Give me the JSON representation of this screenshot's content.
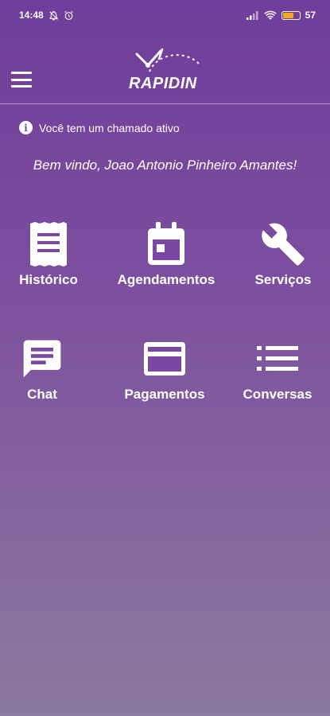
{
  "status_bar": {
    "time": "14:48",
    "battery": "57"
  },
  "header": {
    "logo_text": "RAPIDIN"
  },
  "notice": {
    "text": "Você tem um chamado ativo"
  },
  "welcome": {
    "text": "Bem vindo, Joao Antonio Pinheiro Amantes!"
  },
  "menu": [
    {
      "label": "Histórico",
      "icon": "receipt-icon"
    },
    {
      "label": "Agendamentos",
      "icon": "calendar-icon"
    },
    {
      "label": "Serviços",
      "icon": "wrench-icon"
    },
    {
      "label": "Chat",
      "icon": "chat-icon"
    },
    {
      "label": "Pagamentos",
      "icon": "credit-card-icon"
    },
    {
      "label": "Conversas",
      "icon": "list-icon"
    }
  ],
  "colors": {
    "background_top": "#6f3d9b",
    "background_bottom": "#8d7a9f",
    "text": "#ffffff"
  }
}
